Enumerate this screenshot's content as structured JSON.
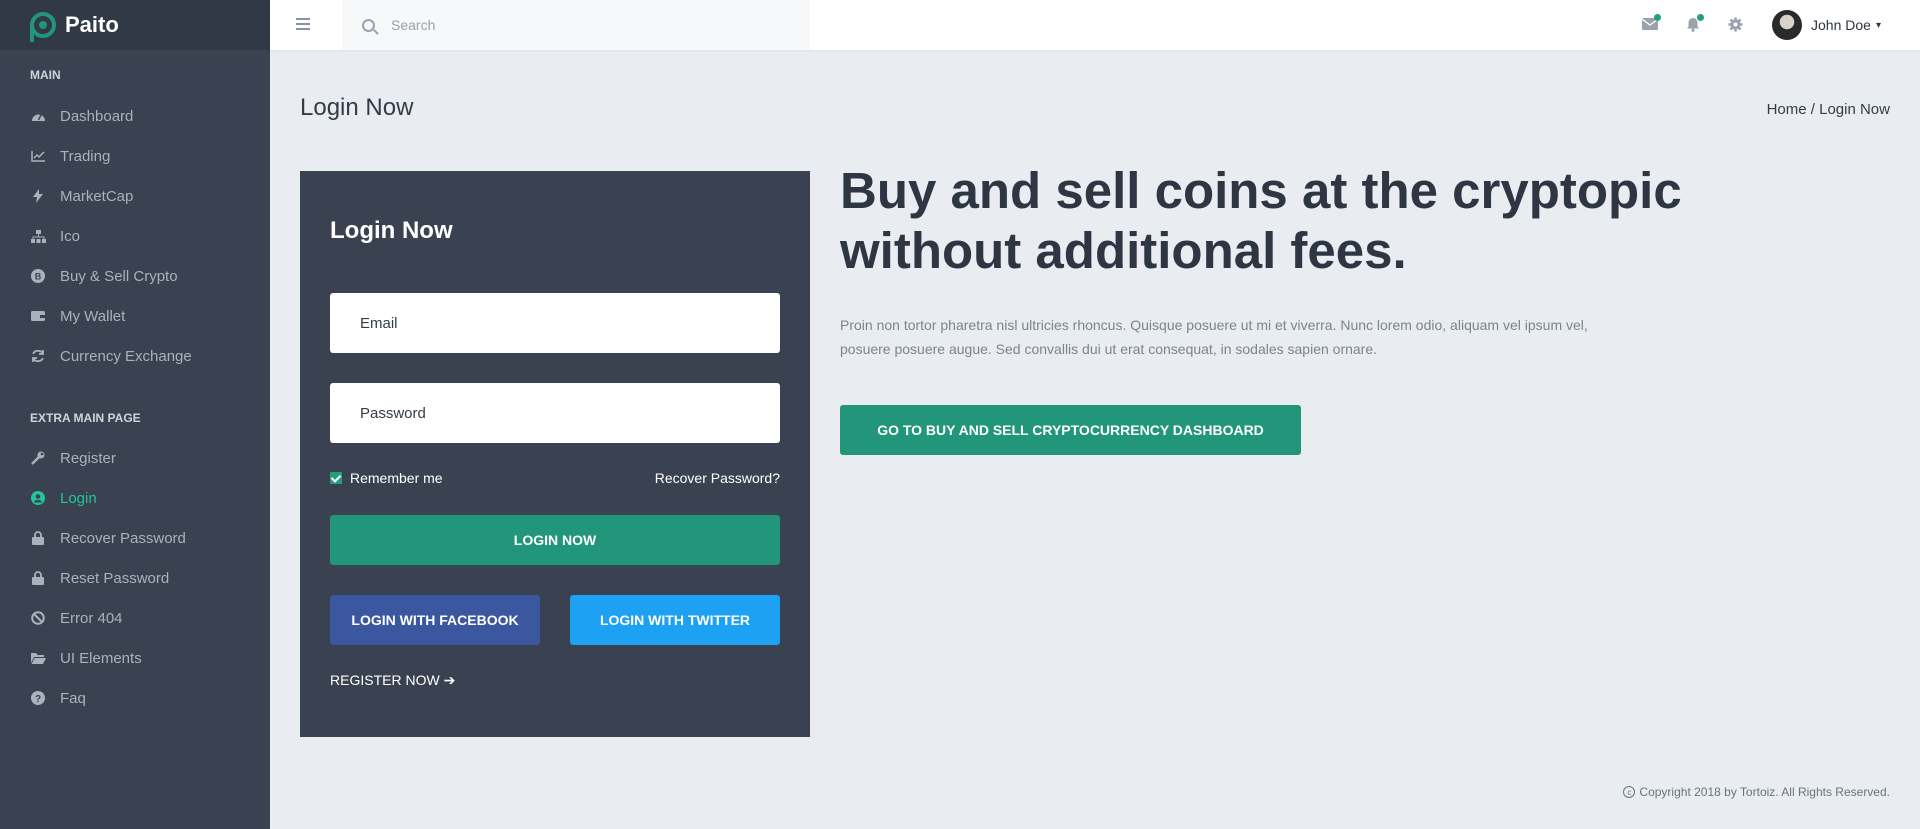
{
  "brand": {
    "name": "Paito"
  },
  "sidebar": {
    "main_title": "MAIN",
    "main_items": [
      {
        "label": "Dashboard",
        "icon": "dashboard-icon"
      },
      {
        "label": "Trading",
        "icon": "chart-icon"
      },
      {
        "label": "MarketCap",
        "icon": "bolt-icon"
      },
      {
        "label": "Ico",
        "icon": "sitemap-icon"
      },
      {
        "label": "Buy & Sell Crypto",
        "icon": "bitcoin-icon"
      },
      {
        "label": "My Wallet",
        "icon": "wallet-icon"
      },
      {
        "label": "Currency Exchange",
        "icon": "refresh-icon"
      }
    ],
    "extra_title": "EXTRA MAIN PAGE",
    "extra_items": [
      {
        "label": "Register",
        "icon": "wrench-icon"
      },
      {
        "label": "Login",
        "icon": "user-circle-icon",
        "active": true
      },
      {
        "label": "Recover Password",
        "icon": "lock-icon"
      },
      {
        "label": "Reset Password",
        "icon": "lock-icon"
      },
      {
        "label": "Error 404",
        "icon": "ban-icon"
      },
      {
        "label": "UI Elements",
        "icon": "folder-icon"
      },
      {
        "label": "Faq",
        "icon": "question-icon"
      }
    ]
  },
  "header": {
    "search_placeholder": "Search",
    "user_name": "John Doe"
  },
  "page": {
    "title": "Login Now",
    "breadcrumb": "Home / Login Now"
  },
  "login": {
    "title": "Login Now",
    "email_placeholder": "Email",
    "password_placeholder": "Password",
    "remember_label": "Remember me",
    "recover_label": "Recover Password?",
    "login_button": "LOGIN NOW",
    "facebook_button": "LOGIN WITH FACEBOOK",
    "twitter_button": "LOGIN WITH TWITTER",
    "register_link": "REGISTER NOW"
  },
  "hero": {
    "heading": "Buy and sell coins at the cryptopic without additional fees.",
    "text": "Proin non tortor pharetra nisl ultricies rhoncus. Quisque posuere ut mi et viverra. Nunc lorem odio, aliquam vel ipsum vel, posuere posuere augue. Sed convallis dui ut erat consequat, in sodales sapien ornare.",
    "cta": "GO TO BUY AND SELL CRYPTOCURRENCY DASHBOARD"
  },
  "footer": {
    "copyright": "Copyright 2018 by Tortoiz. All Rights Reserved."
  },
  "colors": {
    "accent": "#22967a",
    "sidebar": "#3a4251",
    "facebook": "#3b57a0",
    "twitter": "#1da1f2"
  }
}
